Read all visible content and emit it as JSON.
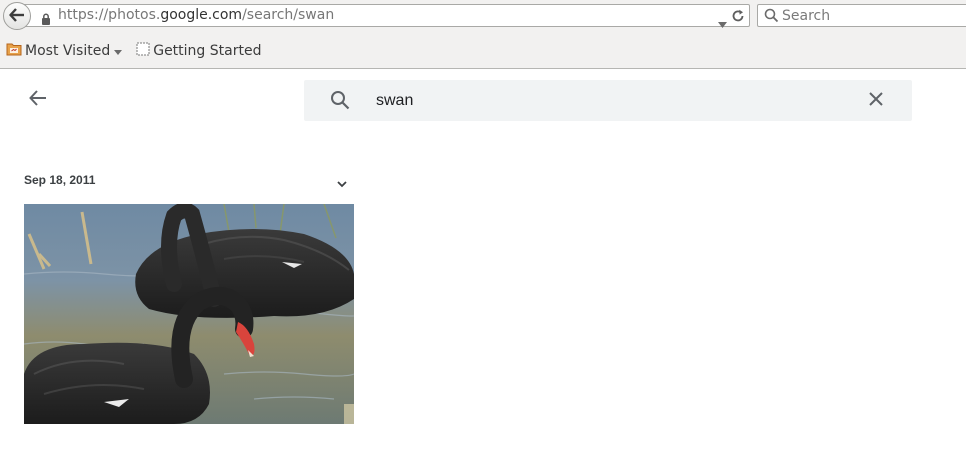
{
  "browser": {
    "url_prefix": "https://photos.",
    "url_host": "google.com",
    "url_path": "/search/swan",
    "search_placeholder": "Search",
    "bookmarks": [
      {
        "label": "Most Visited",
        "icon": "folder-icon"
      },
      {
        "label": "Getting Started",
        "icon": "page-icon"
      }
    ]
  },
  "photos": {
    "search_query": "swan",
    "groups": [
      {
        "date": "Sep 18, 2011",
        "photo_count": 1,
        "photo_subject": "two black swans on water"
      }
    ]
  },
  "colors": {
    "chrome_bg": "#f2f1f0",
    "search_bg": "#f1f3f4",
    "icon_gray": "#5f6368",
    "bookmark_folder": "#e07a2a"
  }
}
